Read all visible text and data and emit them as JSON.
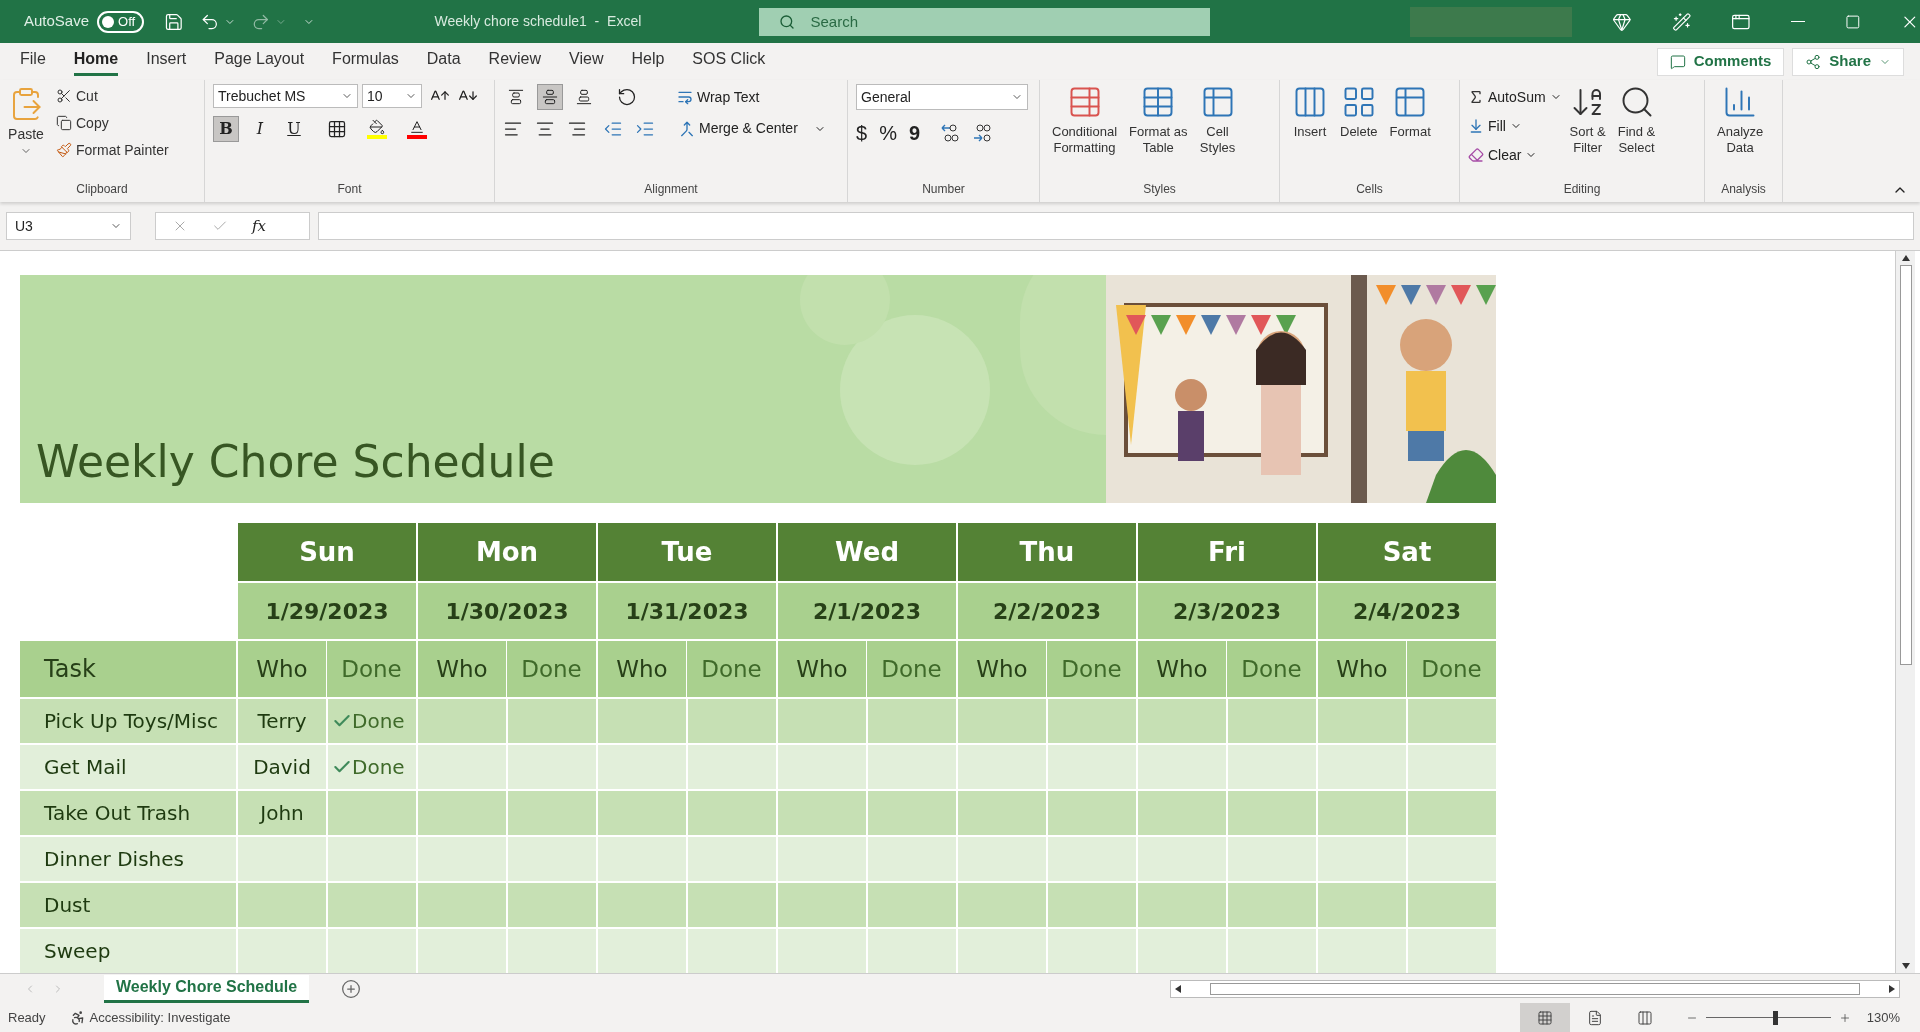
{
  "title_bar": {
    "autosave_label": "AutoSave",
    "autosave": {
      "on": false,
      "label": "Off"
    },
    "title": "Weekly chore schedule1  -  Excel",
    "search": {
      "placeholder": "Search"
    }
  },
  "menu_tabs": [
    {
      "label": "File",
      "selected": false
    },
    {
      "label": "Home",
      "selected": true
    },
    {
      "label": "Insert",
      "selected": false
    },
    {
      "label": "Page Layout",
      "selected": false
    },
    {
      "label": "Formulas",
      "selected": false
    },
    {
      "label": "Data",
      "selected": false
    },
    {
      "label": "Review",
      "selected": false
    },
    {
      "label": "View",
      "selected": false
    },
    {
      "label": "Help",
      "selected": false
    },
    {
      "label": "SOS Click",
      "selected": false
    }
  ],
  "comments_button": "Comments",
  "share_button": "Share",
  "ribbon": {
    "clipboard": {
      "label": "Clipboard",
      "paste": "Paste",
      "items": [
        "Cut",
        "Copy",
        "Format Painter"
      ]
    },
    "font": {
      "label": "Font",
      "font_name": "Trebuchet MS",
      "font_size": "10",
      "toggles": [
        {
          "label": "B",
          "selected": true
        },
        {
          "label": "I",
          "selected": false
        },
        {
          "label": "U",
          "selected": false
        }
      ]
    },
    "alignment": {
      "label": "Alignment",
      "vertical": [
        {
          "selected": false
        },
        {
          "selected": true
        },
        {
          "selected": false
        }
      ],
      "wrap_text": "Wrap Text",
      "merge_center": "Merge & Center"
    },
    "number": {
      "label": "Number",
      "format": "General",
      "symbols": [
        "$",
        "%",
        "9"
      ]
    },
    "styles": {
      "label": "Styles",
      "items": [
        {
          "line1": "Conditional",
          "line2": "Formatting"
        },
        {
          "line1": "Format as",
          "line2": "Table"
        },
        {
          "line1": "Cell",
          "line2": "Styles"
        }
      ]
    },
    "cells": {
      "label": "Cells",
      "items": [
        "Insert",
        "Delete",
        "Format"
      ]
    },
    "editing": {
      "label": "Editing",
      "small": [
        "AutoSum",
        "Fill",
        "Clear"
      ],
      "large": [
        {
          "line1": "Sort &",
          "line2": "Filter"
        },
        {
          "line1": "Find &",
          "line2": "Select"
        }
      ]
    },
    "analysis": {
      "label": "Analysis",
      "item": {
        "line1": "Analyze",
        "line2": "Data"
      }
    }
  },
  "formula_bar": {
    "name_box": "U3",
    "function_label": "fx"
  },
  "sheet": {
    "banner_title": "Weekly Chore Schedule",
    "task_header": "Task",
    "days": [
      {
        "name": "Sun",
        "date": "1/29/2023",
        "who": "Who",
        "done": "Done"
      },
      {
        "name": "Mon",
        "date": "1/30/2023",
        "who": "Who",
        "done": "Done"
      },
      {
        "name": "Tue",
        "date": "1/31/2023",
        "who": "Who",
        "done": "Done"
      },
      {
        "name": "Wed",
        "date": "2/1/2023",
        "who": "Who",
        "done": "Done"
      },
      {
        "name": "Thu",
        "date": "2/2/2023",
        "who": "Who",
        "done": "Done"
      },
      {
        "name": "Fri",
        "date": "2/3/2023",
        "who": "Who",
        "done": "Done"
      },
      {
        "name": "Sat",
        "date": "2/4/2023",
        "who": "Who",
        "done": "Done"
      }
    ],
    "rows": [
      {
        "task": "Pick Up Toys/Misc",
        "who": "Terry",
        "done": "Done"
      },
      {
        "task": "Get Mail",
        "who": "David",
        "done": "Done"
      },
      {
        "task": "Take Out Trash",
        "who": "John"
      },
      {
        "task": "Dinner Dishes"
      },
      {
        "task": "Dust"
      },
      {
        "task": "Sweep"
      }
    ]
  },
  "sheet_tabs": [
    {
      "label": "Weekly Chore Schedule",
      "selected": true
    }
  ],
  "status_bar": {
    "ready": "Ready",
    "accessibility": "Accessibility: Investigate",
    "views": [
      {
        "selected": true
      },
      {
        "selected": false
      },
      {
        "selected": false
      }
    ],
    "zoom": {
      "level": 0.56,
      "reading": "130%"
    }
  }
}
